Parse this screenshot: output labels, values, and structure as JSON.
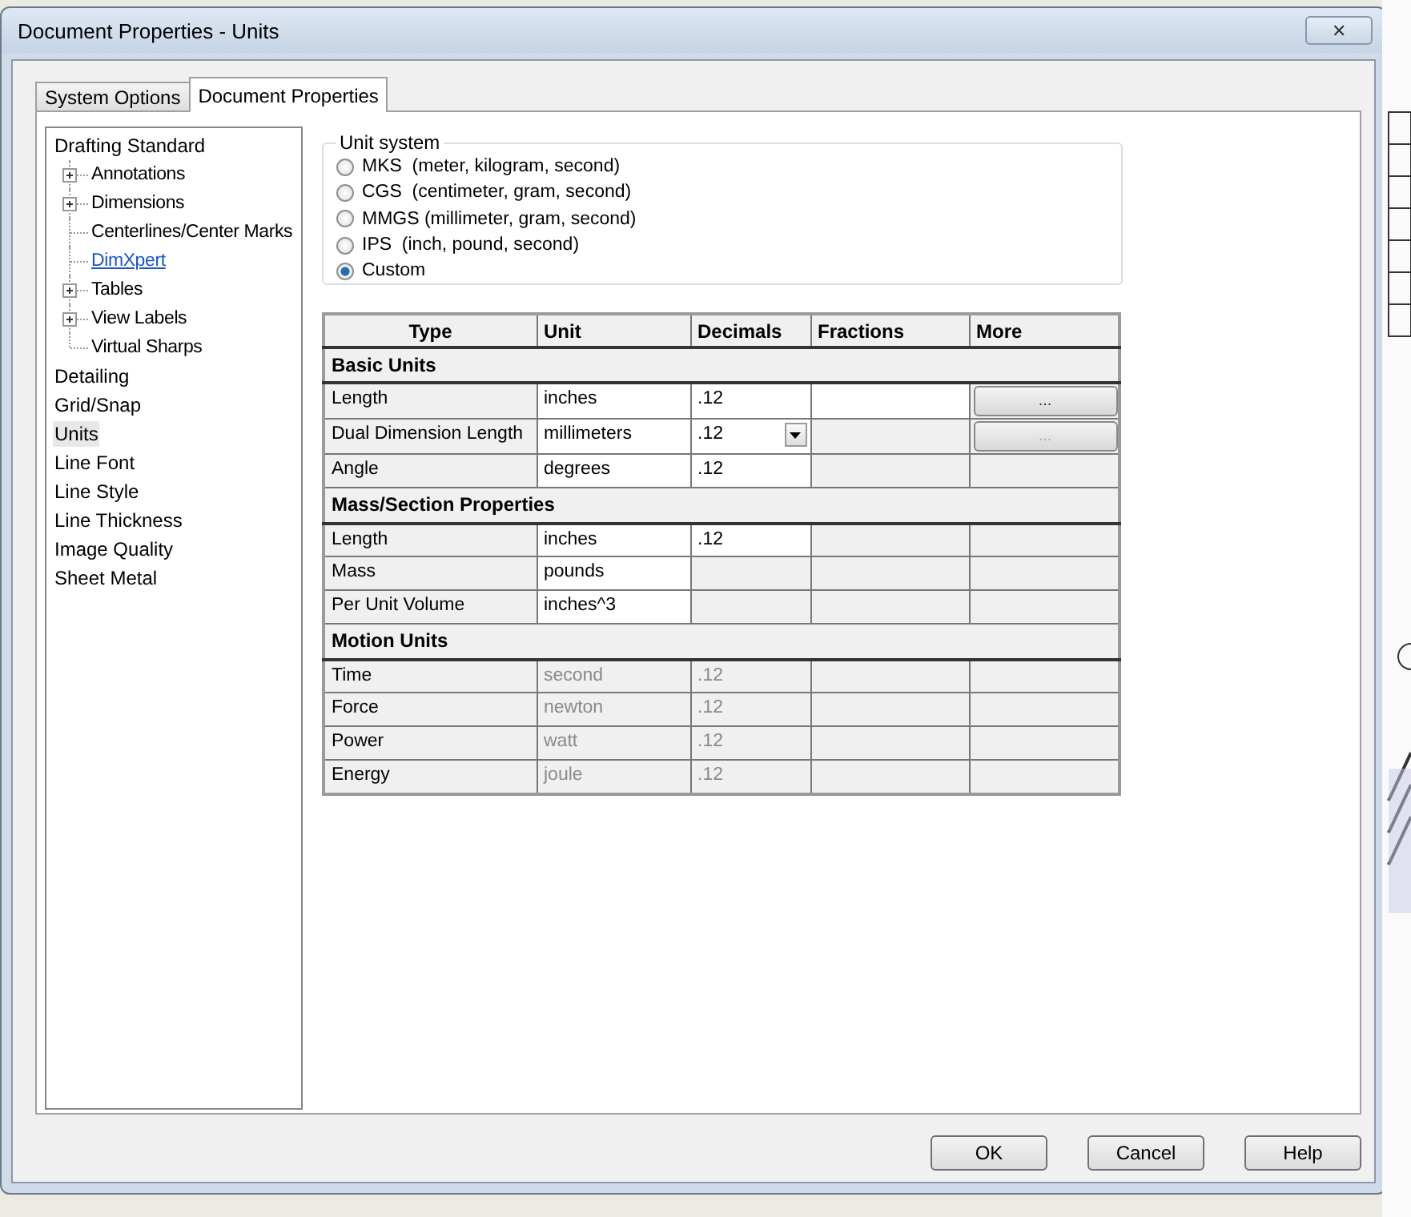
{
  "window": {
    "title": "Document Properties - Units",
    "close": "✕"
  },
  "tabs": [
    {
      "label": "System Options",
      "selected": false
    },
    {
      "label": "Document Properties",
      "selected": true
    }
  ],
  "tree": [
    {
      "label": "Drafting Standard",
      "selected": false,
      "link": false,
      "children": [
        {
          "label": "Annotations",
          "expandable": true,
          "selected": false,
          "link": false
        },
        {
          "label": "Dimensions",
          "expandable": true,
          "selected": false,
          "link": false
        },
        {
          "label": "Centerlines/Center Marks",
          "expandable": false,
          "selected": false,
          "link": false
        },
        {
          "label": "DimXpert",
          "expandable": false,
          "selected": false,
          "link": true
        },
        {
          "label": "Tables",
          "expandable": true,
          "selected": false,
          "link": false
        },
        {
          "label": "View Labels",
          "expandable": true,
          "selected": false,
          "link": false
        },
        {
          "label": "Virtual Sharps",
          "expandable": false,
          "selected": false,
          "link": false
        }
      ]
    },
    {
      "label": "Detailing",
      "selected": false,
      "link": false
    },
    {
      "label": "Grid/Snap",
      "selected": false,
      "link": false
    },
    {
      "label": "Units",
      "selected": true,
      "link": false
    },
    {
      "label": "Line Font",
      "selected": false,
      "link": false
    },
    {
      "label": "Line Style",
      "selected": false,
      "link": false
    },
    {
      "label": "Line Thickness",
      "selected": false,
      "link": false
    },
    {
      "label": "Image Quality",
      "selected": false,
      "link": false
    },
    {
      "label": "Sheet Metal",
      "selected": false,
      "link": false
    }
  ],
  "unit_system": {
    "title": "Unit system",
    "options": [
      {
        "label": "MKS  (meter, kilogram, second)",
        "selected": false
      },
      {
        "label": "CGS  (centimeter, gram, second)",
        "selected": false
      },
      {
        "label": "MMGS (millimeter, gram, second)",
        "selected": false
      },
      {
        "label": "IPS  (inch, pound, second)",
        "selected": false
      },
      {
        "label": "Custom",
        "selected": true
      }
    ]
  },
  "table": {
    "columns": [
      "Type",
      "Unit",
      "Decimals",
      "Fractions",
      "More"
    ],
    "rows": [
      {
        "kind": "section",
        "label": "Basic Units"
      },
      {
        "kind": "row",
        "type": "Length",
        "unit": "inches",
        "unit_editable": true,
        "decimals": ".12",
        "decimals_editable": true,
        "fractions_editable": true,
        "more": "...",
        "more_disabled": false,
        "dimmed": false
      },
      {
        "kind": "row",
        "type": "Dual Dimension Length",
        "unit": "millimeters",
        "unit_editable": true,
        "decimals": ".12",
        "decimals_editable": true,
        "decimals_dropdown": true,
        "fractions_editable": false,
        "more": "...",
        "more_disabled": true,
        "dimmed": false
      },
      {
        "kind": "row",
        "type": "Angle",
        "unit": "degrees",
        "unit_editable": true,
        "decimals": ".12",
        "decimals_editable": true,
        "fractions_editable": false,
        "dimmed": false
      },
      {
        "kind": "section",
        "label": "Mass/Section Properties"
      },
      {
        "kind": "row",
        "type": "Length",
        "unit": "inches",
        "unit_editable": true,
        "decimals": ".12",
        "decimals_editable": true,
        "fractions_editable": false,
        "dimmed": false
      },
      {
        "kind": "row",
        "type": "Mass",
        "unit": "pounds",
        "unit_editable": true,
        "decimals_editable": false,
        "fractions_editable": false,
        "dimmed": false
      },
      {
        "kind": "row",
        "type": "Per Unit Volume",
        "unit": "inches^3",
        "unit_editable": true,
        "decimals_editable": false,
        "fractions_editable": false,
        "dimmed": false
      },
      {
        "kind": "section",
        "label": "Motion Units"
      },
      {
        "kind": "row",
        "type": "Time",
        "unit": "second",
        "unit_editable": false,
        "decimals": ".12",
        "decimals_editable": false,
        "fractions_editable": false,
        "dimmed": true
      },
      {
        "kind": "row",
        "type": "Force",
        "unit": "newton",
        "unit_editable": false,
        "decimals": ".12",
        "decimals_editable": false,
        "fractions_editable": false,
        "dimmed": true
      },
      {
        "kind": "row",
        "type": "Power",
        "unit": "watt",
        "unit_editable": false,
        "decimals": ".12",
        "decimals_editable": false,
        "fractions_editable": false,
        "dimmed": true
      },
      {
        "kind": "row",
        "type": "Energy",
        "unit": "joule",
        "unit_editable": false,
        "decimals": ".12",
        "decimals_editable": false,
        "fractions_editable": false,
        "dimmed": true
      }
    ]
  },
  "buttons": [
    "OK",
    "Cancel",
    "Help"
  ]
}
